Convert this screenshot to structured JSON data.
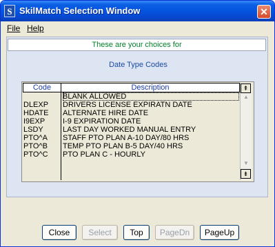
{
  "window": {
    "title": "SkilMatch Selection Window",
    "icon_letter": "S",
    "close_label": "✕"
  },
  "menu": {
    "file": "File",
    "help": "Help"
  },
  "header": {
    "text": "These are your choices for"
  },
  "subtitle": "Date Type Codes",
  "table": {
    "columns": [
      "Code",
      "Description"
    ],
    "rows": [
      {
        "code": "",
        "desc": "BLANK ALLOWED"
      },
      {
        "code": "DLEXP",
        "desc": "DRIVERS LICENSE EXPIRATN DATE"
      },
      {
        "code": "HDATE",
        "desc": "ALTERNATE HIRE DATE"
      },
      {
        "code": "I9EXP",
        "desc": "I-9 EXPIRATION DATE"
      },
      {
        "code": "LSDY",
        "desc": "LAST DAY WORKED MANUAL ENTRY"
      },
      {
        "code": "PTO^A",
        "desc": "STAFF PTO PLAN A-10 DAY/80 HRS"
      },
      {
        "code": "PTO^B",
        "desc": "TEMP PTO PLAN B-5 DAY/40 HRS"
      },
      {
        "code": "PTO^C",
        "desc": "PTO PLAN C - HOURLY"
      }
    ]
  },
  "scrollbar": {
    "top_icon": "⇞",
    "bottom_icon": "⇟",
    "up_arrow": "▲",
    "down_arrow": "▼"
  },
  "buttons": {
    "close": "Close",
    "select": "Select",
    "top": "Top",
    "pagedn": "PageDn",
    "pageup": "PageUp"
  }
}
